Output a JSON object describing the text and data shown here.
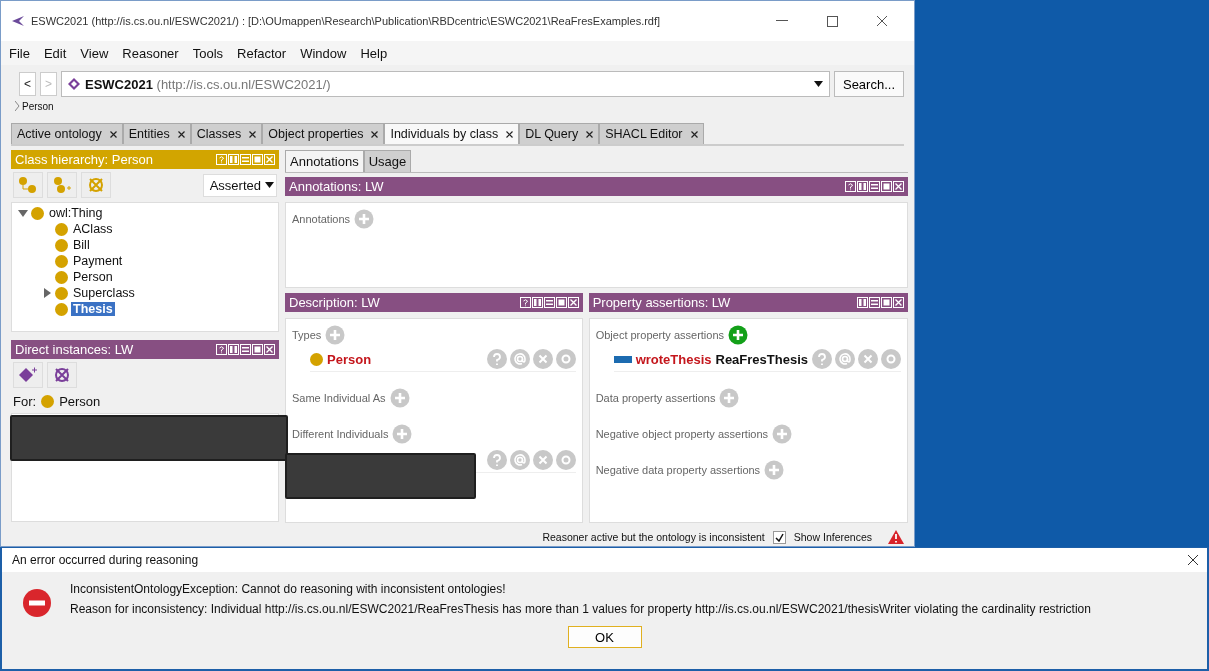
{
  "window": {
    "title": "ESWC2021 (http://is.cs.ou.nl/ESWC2021/)  : [D:\\OUmappen\\Research\\Publication\\RBDcentric\\ESWC2021\\ReaFresExamples.rdf]"
  },
  "menu": [
    "File",
    "Edit",
    "View",
    "Reasoner",
    "Tools",
    "Refactor",
    "Window",
    "Help"
  ],
  "address": {
    "back": "<",
    "forward": ">",
    "back_disabled": false,
    "forward_disabled": true,
    "name": "ESWC2021",
    "iri": "(http://is.cs.ou.nl/ESWC2021/)",
    "search": "Search..."
  },
  "breadcrumb": "Person",
  "tabs": [
    {
      "label": "Active ontology",
      "selected": false
    },
    {
      "label": "Entities",
      "selected": false
    },
    {
      "label": "Classes",
      "selected": false
    },
    {
      "label": "Object properties",
      "selected": false
    },
    {
      "label": "Individuals by class",
      "selected": true
    },
    {
      "label": "DL Query",
      "selected": false
    },
    {
      "label": "SHACL Editor",
      "selected": false
    }
  ],
  "class_hierarchy": {
    "title": "Class hierarchy: Person",
    "help": true,
    "mode": "Asserted",
    "tree": [
      {
        "label": "owl:Thing",
        "expanded": true,
        "selected": false,
        "children": [
          {
            "label": "AClass",
            "selected": false
          },
          {
            "label": "Bill",
            "selected": false
          },
          {
            "label": "Payment",
            "selected": false
          },
          {
            "label": "Person",
            "selected": false
          },
          {
            "label": "Superclass",
            "expanded": false,
            "selected": false
          },
          {
            "label": "Thesis",
            "selected": true
          }
        ]
      }
    ]
  },
  "direct_instances": {
    "title": "Direct instances: LW",
    "help": true,
    "for_label": "For:",
    "for_class": "Person"
  },
  "detail_tabs": [
    {
      "label": "Annotations",
      "selected": true
    },
    {
      "label": "Usage",
      "selected": false
    }
  ],
  "annotations": {
    "title": "Annotations: LW",
    "help": true,
    "label": "Annotations"
  },
  "description": {
    "title": "Description: LW",
    "help": true,
    "sections": [
      {
        "label": "Types",
        "add_active": false,
        "items": [
          {
            "kind": "class",
            "name": "Person"
          }
        ]
      },
      {
        "label": "Same Individual As",
        "add_active": false
      },
      {
        "label": "Different Individuals",
        "add_active": false,
        "items": [
          {
            "kind": "hidden"
          }
        ]
      }
    ]
  },
  "property_assertions": {
    "title": "Property assertions: LW",
    "sections": [
      {
        "label": "Object property assertions",
        "add_active": true,
        "items": [
          {
            "kind": "object",
            "property": "wroteThesis",
            "value": "ReaFresThesis"
          }
        ]
      },
      {
        "label": "Data property assertions",
        "add_active": false
      },
      {
        "label": "Negative object property assertions",
        "add_active": false
      },
      {
        "label": "Negative data property assertions",
        "add_active": false
      }
    ]
  },
  "status": {
    "text": "Reasoner active but the ontology is inconsistent",
    "show_inferences": {
      "label": "Show Inferences",
      "checked": true
    }
  },
  "dialog": {
    "title": "An error occurred during reasoning",
    "lines": [
      "InconsistentOntologyException: Cannot do reasoning with inconsistent ontologies!",
      "Reason for inconsistency: Individual http://is.cs.ou.nl/ESWC2021/ReaFresThesis has more than 1 values for property http://is.cs.ou.nl/ESWC2021/thesisWriter violating the cardinality restriction"
    ],
    "ok": "OK"
  }
}
